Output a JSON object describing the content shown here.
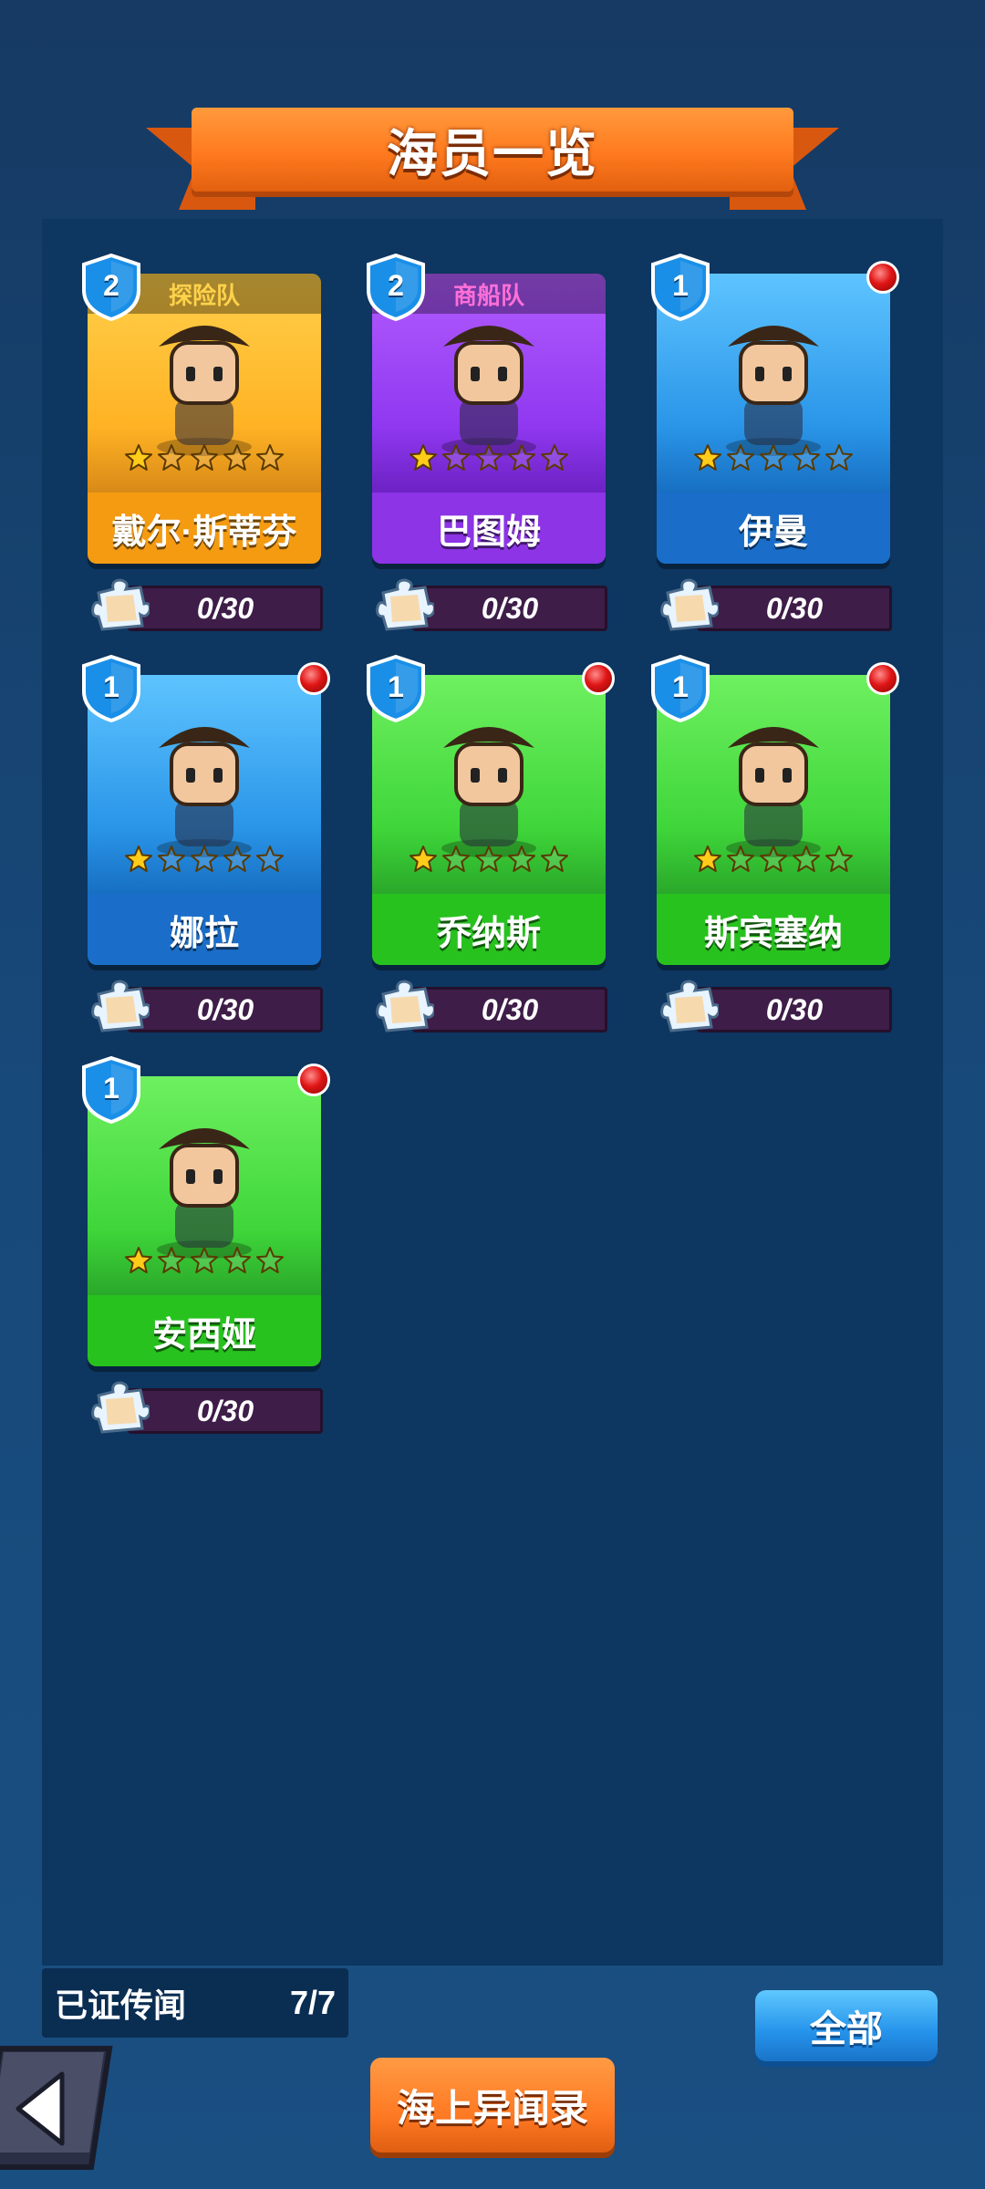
{
  "header": {
    "title": "海员一览"
  },
  "crew": [
    {
      "name": "戴尔·斯蒂芬",
      "level": "2",
      "team": "探险队",
      "theme": "gold",
      "progress": "0/30",
      "stars_filled": 1,
      "stars_total": 5,
      "has_alert": false
    },
    {
      "name": "巴图姆",
      "level": "2",
      "team": "商船队",
      "theme": "purple",
      "progress": "0/30",
      "stars_filled": 1,
      "stars_total": 5,
      "has_alert": false
    },
    {
      "name": "伊曼",
      "level": "1",
      "team": "",
      "theme": "blue",
      "progress": "0/30",
      "stars_filled": 1,
      "stars_total": 5,
      "has_alert": true
    },
    {
      "name": "娜拉",
      "level": "1",
      "team": "",
      "theme": "blue",
      "progress": "0/30",
      "stars_filled": 1,
      "stars_total": 5,
      "has_alert": true
    },
    {
      "name": "乔纳斯",
      "level": "1",
      "team": "",
      "theme": "green",
      "progress": "0/30",
      "stars_filled": 1,
      "stars_total": 5,
      "has_alert": true
    },
    {
      "name": "斯宾塞纳",
      "level": "1",
      "team": "",
      "theme": "green",
      "progress": "0/30",
      "stars_filled": 1,
      "stars_total": 5,
      "has_alert": true
    },
    {
      "name": "安西娅",
      "level": "1",
      "team": "",
      "theme": "green",
      "progress": "0/30",
      "stars_filled": 1,
      "stars_total": 5,
      "has_alert": true
    }
  ],
  "footer": {
    "verified_label": "已证传闻",
    "verified_value": "7/7",
    "all_button": "全部",
    "legend_button": "海上异闻录"
  },
  "colors": {
    "accent_orange": "#ff7a1f",
    "panel_bg": "#0d3660",
    "alert_red": "#e01515"
  }
}
